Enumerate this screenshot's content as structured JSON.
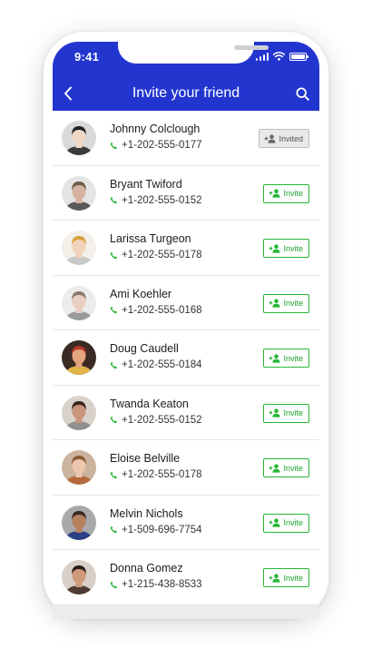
{
  "status": {
    "time": "9:41"
  },
  "header": {
    "title": "Invite your friend"
  },
  "colors": {
    "header": "#2335cf",
    "invite": "#27b636",
    "phone_icon": "#27b636",
    "invited_bg": "#e9e9ec"
  },
  "icons": {
    "back": "chevron-left-icon",
    "search": "search-icon",
    "phone": "phone-icon",
    "add_user": "add-user-icon"
  },
  "contacts": [
    {
      "name": "Johnny Colclough",
      "phone": "+1-202-555-0177",
      "action": "Invited",
      "invited": true
    },
    {
      "name": "Bryant Twiford",
      "phone": "+1-202-555-0152",
      "action": "Invite",
      "invited": false
    },
    {
      "name": "Larissa Turgeon",
      "phone": "+1-202-555-0178",
      "action": "Invite",
      "invited": false
    },
    {
      "name": "Ami Koehler",
      "phone": "+1-202-555-0168",
      "action": "Invite",
      "invited": false
    },
    {
      "name": "Doug Caudell",
      "phone": "+1-202-555-0184",
      "action": "Invite",
      "invited": false
    },
    {
      "name": "Twanda Keaton",
      "phone": "+1-202-555-0152",
      "action": "Invite",
      "invited": false
    },
    {
      "name": "Eloise Belville",
      "phone": "+1-202-555-0178",
      "action": "Invite",
      "invited": false
    },
    {
      "name": "Melvin Nichols",
      "phone": "+1-509-696-7754",
      "action": "Invite",
      "invited": false
    },
    {
      "name": "Donna Gomez",
      "phone": "+1-215-438-8533",
      "action": "Invite",
      "invited": false
    }
  ]
}
